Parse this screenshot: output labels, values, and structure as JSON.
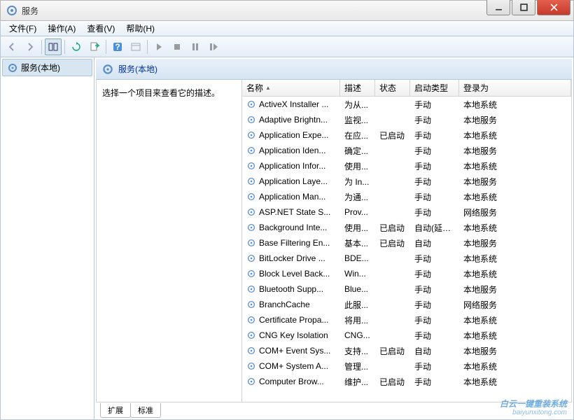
{
  "window": {
    "title": "服务"
  },
  "menu": {
    "file": "文件(F)",
    "action": "操作(A)",
    "view": "查看(V)",
    "help": "帮助(H)"
  },
  "tree": {
    "root": "服务(本地)"
  },
  "pane": {
    "title": "服务(本地)"
  },
  "desc_prompt": "选择一个项目来查看它的描述。",
  "columns": {
    "name": "名称",
    "desc": "描述",
    "status": "状态",
    "startup": "启动类型",
    "logon": "登录为"
  },
  "tabs": {
    "extended": "扩展",
    "standard": "标准"
  },
  "services": [
    {
      "name": "ActiveX Installer ...",
      "desc": "为从...",
      "status": "",
      "startup": "手动",
      "logon": "本地系统"
    },
    {
      "name": "Adaptive Brightn...",
      "desc": "监视...",
      "status": "",
      "startup": "手动",
      "logon": "本地服务"
    },
    {
      "name": "Application Expe...",
      "desc": "在应...",
      "status": "已启动",
      "startup": "手动",
      "logon": "本地系统"
    },
    {
      "name": "Application Iden...",
      "desc": "确定...",
      "status": "",
      "startup": "手动",
      "logon": "本地服务"
    },
    {
      "name": "Application Infor...",
      "desc": "使用...",
      "status": "",
      "startup": "手动",
      "logon": "本地系统"
    },
    {
      "name": "Application Laye...",
      "desc": "为 In...",
      "status": "",
      "startup": "手动",
      "logon": "本地服务"
    },
    {
      "name": "Application Man...",
      "desc": "为通...",
      "status": "",
      "startup": "手动",
      "logon": "本地系统"
    },
    {
      "name": "ASP.NET State S...",
      "desc": "Prov...",
      "status": "",
      "startup": "手动",
      "logon": "网络服务"
    },
    {
      "name": "Background Inte...",
      "desc": "使用...",
      "status": "已启动",
      "startup": "自动(延迟...",
      "logon": "本地系统"
    },
    {
      "name": "Base Filtering En...",
      "desc": "基本...",
      "status": "已启动",
      "startup": "自动",
      "logon": "本地服务"
    },
    {
      "name": "BitLocker Drive ...",
      "desc": "BDE...",
      "status": "",
      "startup": "手动",
      "logon": "本地系统"
    },
    {
      "name": "Block Level Back...",
      "desc": "Win...",
      "status": "",
      "startup": "手动",
      "logon": "本地系统"
    },
    {
      "name": "Bluetooth Supp...",
      "desc": "Blue...",
      "status": "",
      "startup": "手动",
      "logon": "本地服务"
    },
    {
      "name": "BranchCache",
      "desc": "此服...",
      "status": "",
      "startup": "手动",
      "logon": "网络服务"
    },
    {
      "name": "Certificate Propa...",
      "desc": "将用...",
      "status": "",
      "startup": "手动",
      "logon": "本地系统"
    },
    {
      "name": "CNG Key Isolation",
      "desc": "CNG...",
      "status": "",
      "startup": "手动",
      "logon": "本地系统"
    },
    {
      "name": "COM+ Event Sys...",
      "desc": "支持...",
      "status": "已启动",
      "startup": "自动",
      "logon": "本地服务"
    },
    {
      "name": "COM+ System A...",
      "desc": "管理...",
      "status": "",
      "startup": "手动",
      "logon": "本地系统"
    },
    {
      "name": "Computer Brow...",
      "desc": "维护...",
      "status": "已启动",
      "startup": "手动",
      "logon": "本地系统"
    }
  ],
  "watermark": {
    "main": "白云一键重装系统",
    "sub": "baiyunxitong.com"
  }
}
